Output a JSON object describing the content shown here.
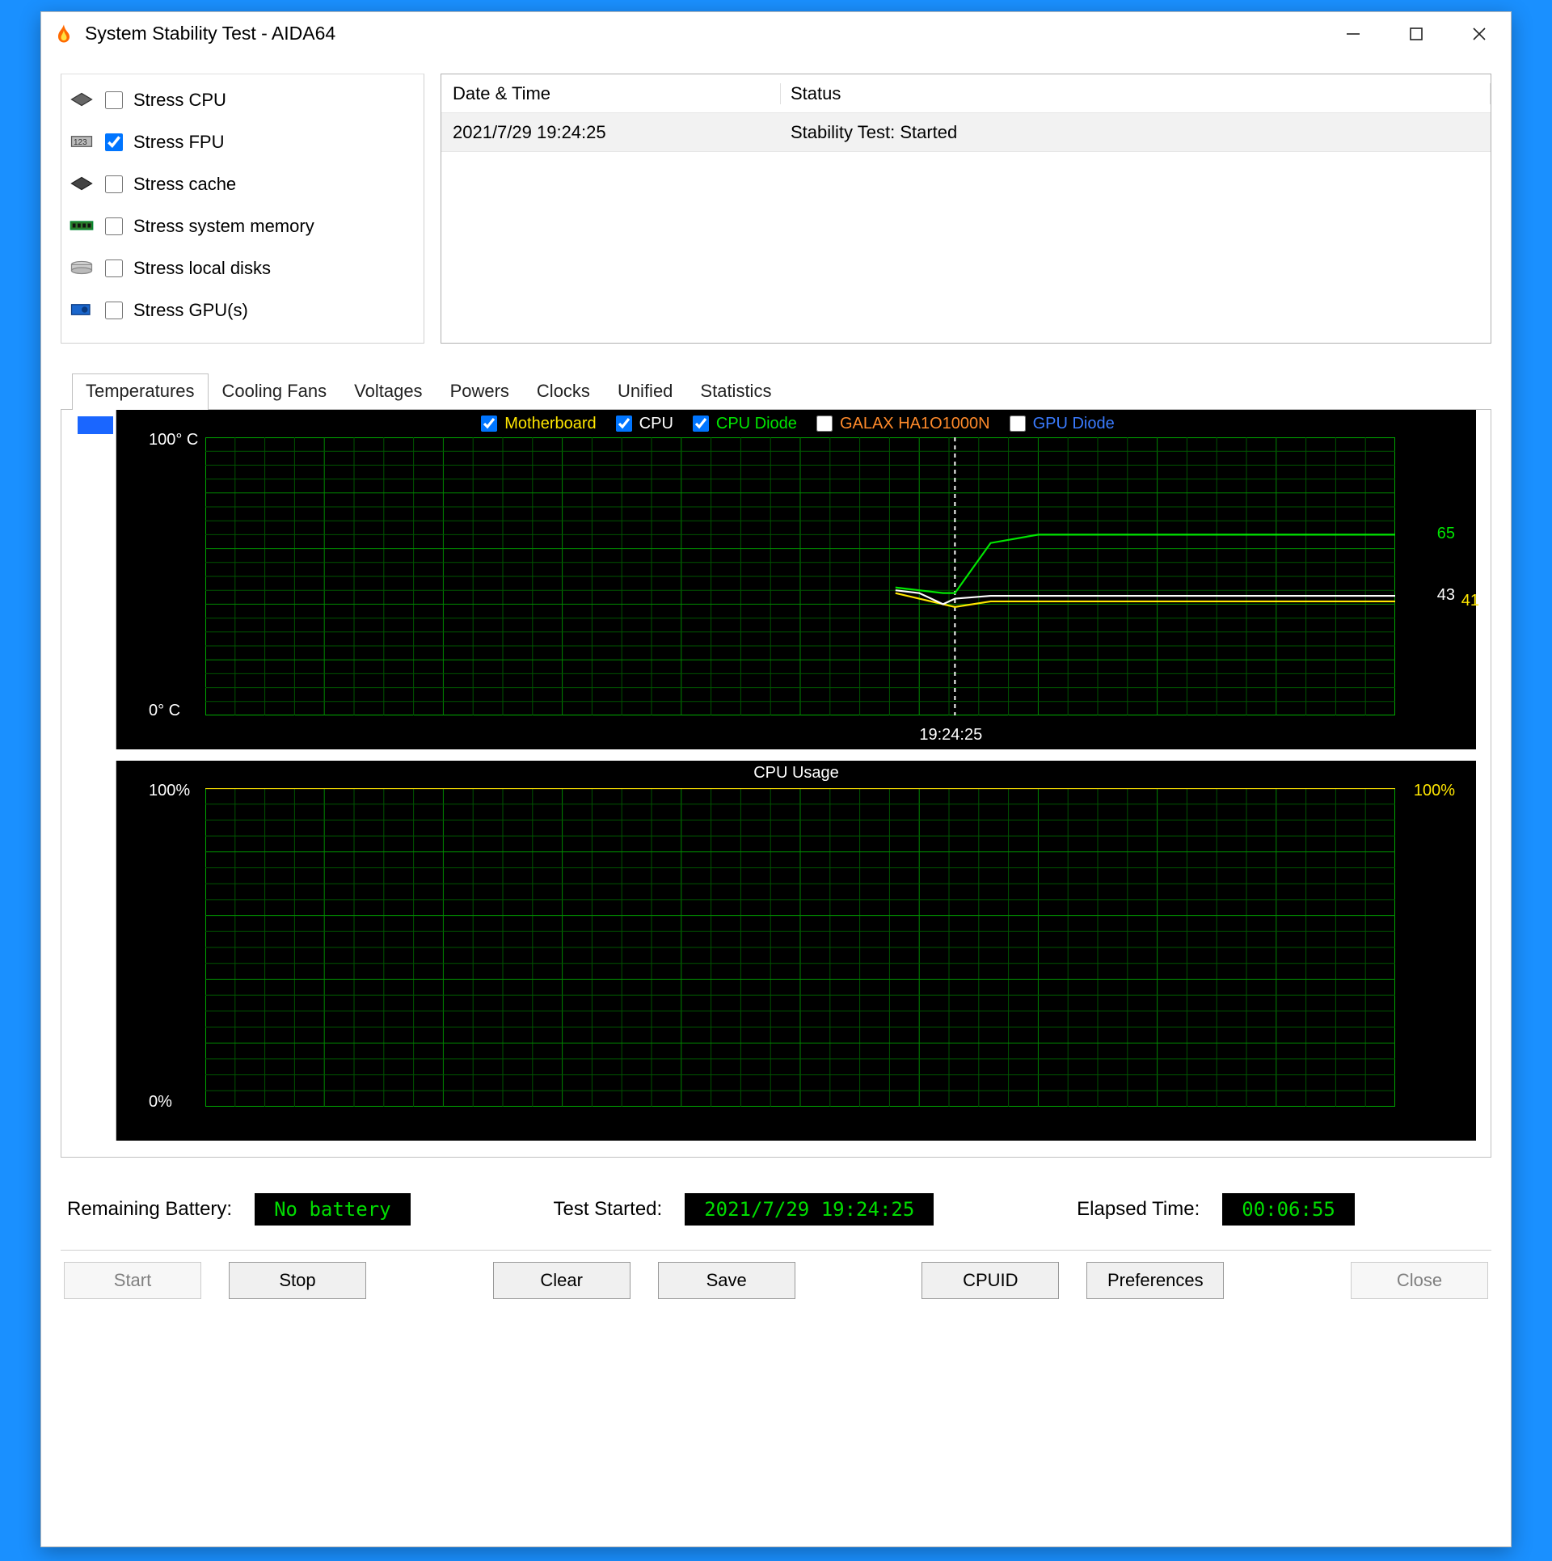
{
  "window": {
    "title": "System Stability Test - AIDA64"
  },
  "stress": {
    "items": [
      {
        "label": "Stress CPU",
        "checked": false,
        "icon": "cpu"
      },
      {
        "label": "Stress FPU",
        "checked": true,
        "icon": "fpu"
      },
      {
        "label": "Stress cache",
        "checked": false,
        "icon": "cache"
      },
      {
        "label": "Stress system memory",
        "checked": false,
        "icon": "memory"
      },
      {
        "label": "Stress local disks",
        "checked": false,
        "icon": "disk"
      },
      {
        "label": "Stress GPU(s)",
        "checked": false,
        "icon": "gpu"
      }
    ]
  },
  "log": {
    "headers": [
      "Date & Time",
      "Status"
    ],
    "rows": [
      {
        "time": "2021/7/29 19:24:25",
        "status": "Stability Test: Started"
      }
    ]
  },
  "tabs": [
    "Temperatures",
    "Cooling Fans",
    "Voltages",
    "Powers",
    "Clocks",
    "Unified",
    "Statistics"
  ],
  "activeTab": 0,
  "tempGraph": {
    "yTop": "100° C",
    "yBot": "0° C",
    "xLabel": "19:24:25",
    "legend": [
      {
        "label": "Motherboard",
        "color": "#ffe600",
        "checked": true
      },
      {
        "label": "CPU",
        "color": "#ffffff",
        "checked": true
      },
      {
        "label": "CPU Diode",
        "color": "#00e600",
        "checked": true
      },
      {
        "label": "GALAX HA1O1000N",
        "color": "#ff8a2a",
        "checked": false
      },
      {
        "label": "GPU Diode",
        "color": "#3a7bff",
        "checked": false
      }
    ],
    "readouts": [
      {
        "label": "65",
        "color": "#00e600",
        "percent": 65
      },
      {
        "label": "43",
        "color": "#ffffff",
        "percent": 43
      },
      {
        "label": "41",
        "color": "#ffe600",
        "percent": 41
      }
    ]
  },
  "cpuGraph": {
    "title": "CPU Usage",
    "yTop": "100%",
    "yBot": "0%",
    "rRead": "100%",
    "rColor": "#ffe600"
  },
  "status": {
    "battLabel": "Remaining Battery:",
    "battVal": "No battery",
    "startedLabel": "Test Started:",
    "startedVal": "2021/7/29 19:24:25",
    "elapsedLabel": "Elapsed Time:",
    "elapsedVal": "00:06:55"
  },
  "buttons": {
    "start": "Start",
    "stop": "Stop",
    "clear": "Clear",
    "save": "Save",
    "cpuid": "CPUID",
    "prefs": "Preferences",
    "close": "Close"
  },
  "chart_data": [
    {
      "type": "line",
      "title": "Temperatures",
      "ylabel": "°C",
      "ylim": [
        0,
        100
      ],
      "x_marker": "19:24:25",
      "x_marker_fraction": 0.63,
      "series": [
        {
          "name": "Motherboard",
          "color": "#ffe600",
          "current": 41,
          "points_x_frac": [
            0.58,
            0.6,
            0.62,
            0.63,
            0.66,
            0.8,
            1.0
          ],
          "points_y": [
            44,
            42,
            40,
            39,
            41,
            41,
            41
          ]
        },
        {
          "name": "CPU",
          "color": "#ffffff",
          "current": 43,
          "points_x_frac": [
            0.58,
            0.6,
            0.62,
            0.63,
            0.66,
            0.8,
            1.0
          ],
          "points_y": [
            45,
            44,
            40,
            42,
            43,
            43,
            43
          ]
        },
        {
          "name": "CPU Diode",
          "color": "#00e600",
          "current": 65,
          "points_x_frac": [
            0.58,
            0.6,
            0.62,
            0.63,
            0.66,
            0.7,
            0.8,
            1.0
          ],
          "points_y": [
            46,
            45,
            44,
            44,
            62,
            65,
            65,
            65
          ]
        }
      ]
    },
    {
      "type": "line",
      "title": "CPU Usage",
      "ylabel": "%",
      "ylim": [
        0,
        100
      ],
      "series": [
        {
          "name": "CPU Usage",
          "color": "#ffe600",
          "current": 100,
          "points_x_frac": [
            0.0,
            1.0
          ],
          "points_y": [
            100,
            100
          ]
        }
      ]
    }
  ]
}
